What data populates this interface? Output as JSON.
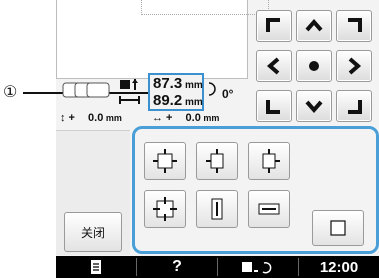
{
  "callout": {
    "marker": "①"
  },
  "size_readout": {
    "height_value": "87.3",
    "width_value": "89.2",
    "unit": "mm"
  },
  "rotation": {
    "value": "0°"
  },
  "offset_readout": {
    "v_value": "0.0",
    "h_value": "0.0",
    "unit": "mm"
  },
  "direction_pad": [
    {
      "name": "top-left-corner-icon"
    },
    {
      "name": "up-arrow-icon"
    },
    {
      "name": "top-right-corner-icon"
    },
    {
      "name": "left-arrow-icon"
    },
    {
      "name": "center-dot-icon"
    },
    {
      "name": "right-arrow-icon"
    },
    {
      "name": "bottom-left-corner-icon"
    },
    {
      "name": "down-arrow-icon"
    },
    {
      "name": "bottom-right-corner-icon"
    }
  ],
  "resize_buttons": [
    {
      "name": "resize-proportional-icon"
    },
    {
      "name": "resize-width-left-icon"
    },
    {
      "name": "resize-width-right-icon"
    },
    {
      "name": "resize-all-directions-icon"
    },
    {
      "name": "resize-height-icon"
    },
    {
      "name": "resize-horizontal-icon"
    }
  ],
  "close_button": {
    "label": "关闭"
  },
  "bottom_bar": {
    "help_label": "?",
    "clock": "12:00"
  },
  "colors": {
    "accent": "#4a9fd8",
    "callout_border": "#3b90cf",
    "bar": "#000000"
  }
}
